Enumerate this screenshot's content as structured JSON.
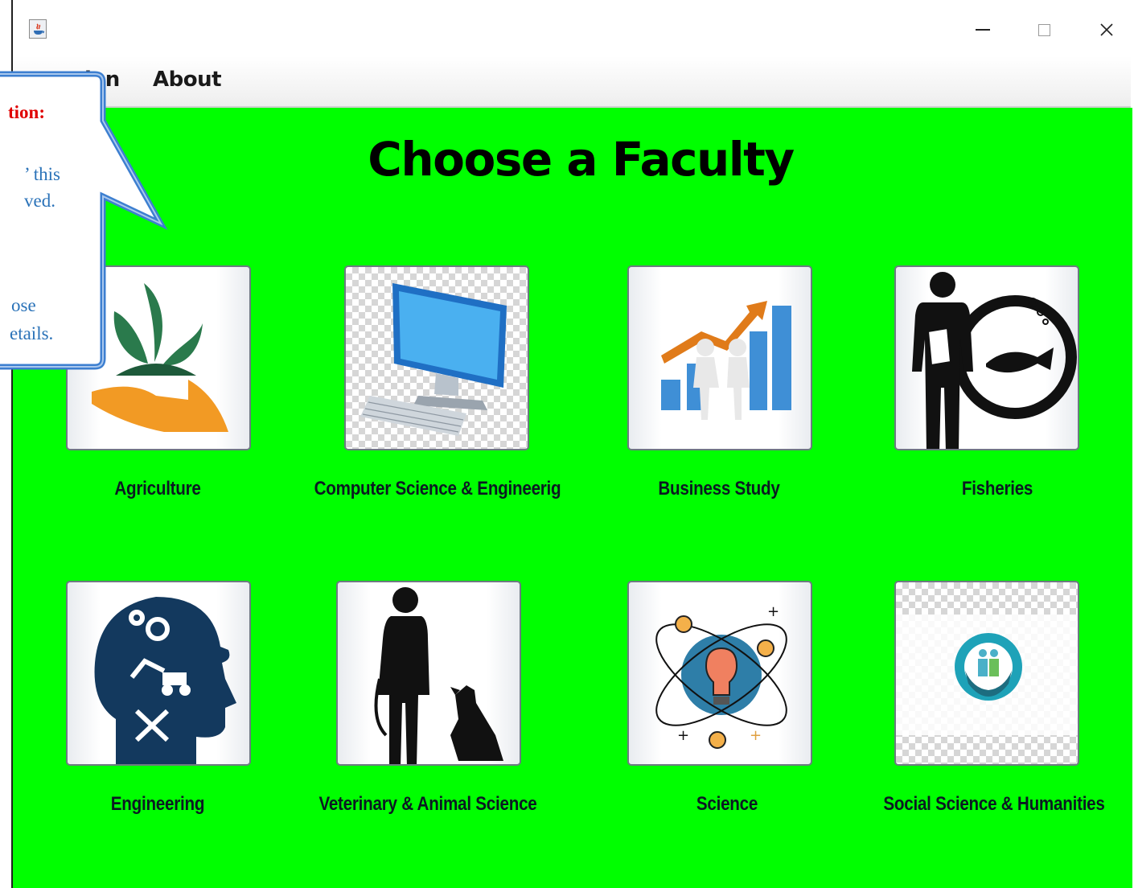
{
  "window": {
    "title": "",
    "controls": {
      "minimize": "–",
      "maximize": "☐",
      "close": "X"
    }
  },
  "menu": {
    "items": [
      "ation",
      "About"
    ]
  },
  "page_title": "Choose a Faculty",
  "faculties": [
    {
      "label": "Agriculture",
      "icon": "plant-in-hand-icon"
    },
    {
      "label": "Computer Science & Engineerig",
      "icon": "desktop-computer-icon"
    },
    {
      "label": "Business Study",
      "icon": "business-growth-icon"
    },
    {
      "label": "Fisheries",
      "icon": "person-with-fish-icon"
    },
    {
      "label": "Engineering",
      "icon": "engineer-head-icon"
    },
    {
      "label": "Veterinary & Animal Science",
      "icon": "vet-with-dog-icon"
    },
    {
      "label": "Science",
      "icon": "atom-bulb-icon"
    },
    {
      "label": "Social Science & Humanities",
      "icon": "family-in-hands-icon"
    }
  ],
  "callout": {
    "title": "tion:",
    "lines": [
      "’ this",
      "ved.",
      "ose",
      "etails."
    ]
  },
  "colors": {
    "background": "#00ff00",
    "callout_border": "#3d7fd0",
    "callout_title": "#e00000",
    "callout_text": "#2a72b8"
  }
}
